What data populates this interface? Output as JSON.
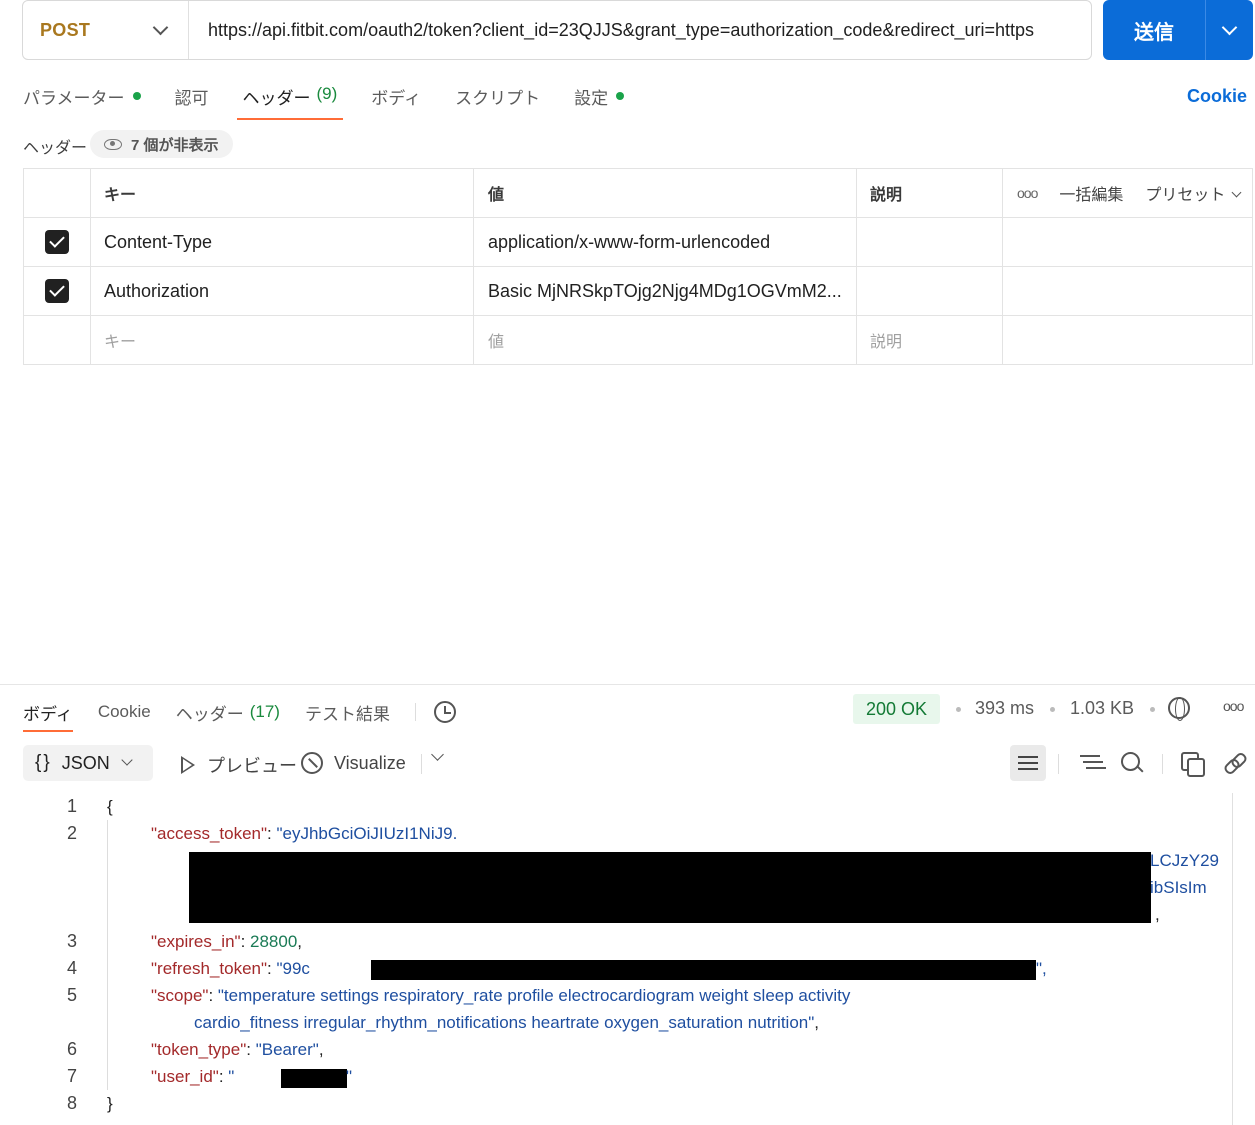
{
  "request": {
    "method": "POST",
    "url": "https://api.fitbit.com/oauth2/token?client_id=23QJJS&grant_type=authorization_code&redirect_uri=https",
    "send_label": "送信"
  },
  "tabs": {
    "params": "パラメーター",
    "auth": "認可",
    "headers": "ヘッダー",
    "headers_count": "(9)",
    "body": "ボディ",
    "scripts": "スクリプト",
    "settings": "設定",
    "cookies": "Cookie"
  },
  "headers_section": {
    "title": "ヘッダー",
    "hidden": "7 個が非表示",
    "columns": {
      "key": "キー",
      "value": "値",
      "description": "説明",
      "bulk_edit": "一括編集",
      "presets": "プリセット",
      "more": "ooo"
    },
    "rows": [
      {
        "key": "Content-Type",
        "value": "application/x-www-form-urlencoded",
        "description": ""
      },
      {
        "key": "Authorization",
        "value": "Basic MjNRSkpTOjg2Njg4MDg1OGVmM2...",
        "description": ""
      }
    ],
    "placeholders": {
      "key": "キー",
      "value": "値",
      "description": "説明"
    }
  },
  "response": {
    "tabs": {
      "body": "ボディ",
      "cookies": "Cookie",
      "headers": "ヘッダー",
      "headers_count": "(17)",
      "tests": "テスト結果"
    },
    "status": "200 OK",
    "time": "393 ms",
    "size": "1.03 KB",
    "more": "ooo",
    "format": "JSON",
    "preview": "プレビュー",
    "visualize": "Visualize",
    "code": {
      "line_numbers": [
        "1",
        "2",
        "3",
        "4",
        "5",
        "6",
        "7",
        "8"
      ],
      "open_brace": "{",
      "close_brace": "}",
      "access_token_key": "\"access_token\"",
      "access_token_val": "\"eyJhbGciOiJIUzI1NiJ9.",
      "access_token_tail1": "LCJzY29",
      "access_token_tail2": "ibSIsIm",
      "access_token_tail3": ",",
      "expires_in_key": "\"expires_in\"",
      "expires_in_val": "28800",
      "refresh_token_key": "\"refresh_token\"",
      "refresh_token_val": "\"99c",
      "refresh_token_end": "\",",
      "scope_key": "\"scope\"",
      "scope_val_1": "\"temperature settings respiratory_rate profile electrocardiogram weight sleep activity",
      "scope_val_2": "cardio_fitness irregular_rhythm_notifications heartrate oxygen_saturation nutrition\"",
      "token_type_key": "\"token_type\"",
      "token_type_val": "\"Bearer\"",
      "user_id_key": "\"user_id\"",
      "user_id_open": "\"",
      "user_id_close": "\""
    }
  }
}
